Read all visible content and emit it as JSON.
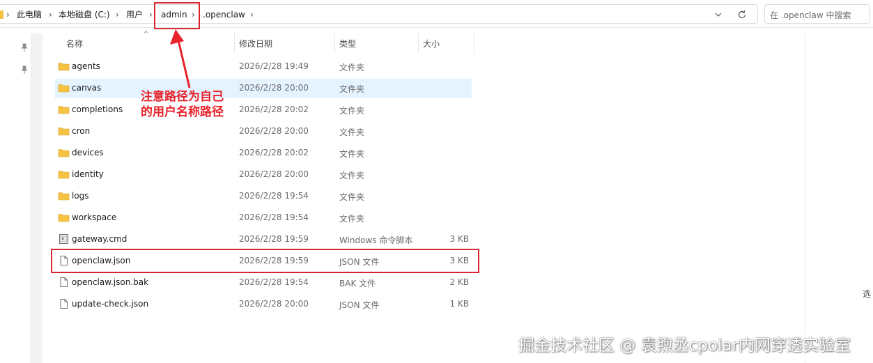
{
  "breadcrumb": {
    "items": [
      "此电脑",
      "本地磁盘 (C:)",
      "用户",
      "admin",
      ".openclaw"
    ]
  },
  "search": {
    "placeholder": "在 .openclaw 中搜索"
  },
  "columns": {
    "name": "名称",
    "modified": "修改日期",
    "type": "类型",
    "size": "大小"
  },
  "files": [
    {
      "name": "agents",
      "date": "2026/2/28 19:49",
      "type": "文件夹",
      "size": "",
      "icon": "folder-icon",
      "selected": false
    },
    {
      "name": "canvas",
      "date": "2026/2/28 20:00",
      "type": "文件夹",
      "size": "",
      "icon": "folder-icon",
      "selected": true
    },
    {
      "name": "completions",
      "date": "2026/2/28 20:02",
      "type": "文件夹",
      "size": "",
      "icon": "folder-icon",
      "selected": false
    },
    {
      "name": "cron",
      "date": "2026/2/28 20:00",
      "type": "文件夹",
      "size": "",
      "icon": "folder-icon",
      "selected": false
    },
    {
      "name": "devices",
      "date": "2026/2/28 20:02",
      "type": "文件夹",
      "size": "",
      "icon": "folder-icon",
      "selected": false
    },
    {
      "name": "identity",
      "date": "2026/2/28 20:00",
      "type": "文件夹",
      "size": "",
      "icon": "folder-icon",
      "selected": false
    },
    {
      "name": "logs",
      "date": "2026/2/28 19:54",
      "type": "文件夹",
      "size": "",
      "icon": "folder-icon",
      "selected": false
    },
    {
      "name": "workspace",
      "date": "2026/2/28 19:54",
      "type": "文件夹",
      "size": "",
      "icon": "folder-icon",
      "selected": false
    },
    {
      "name": "gateway.cmd",
      "date": "2026/2/28 19:59",
      "type": "Windows 命令脚本",
      "size": "3 KB",
      "icon": "script-file-icon",
      "selected": false
    },
    {
      "name": "openclaw.json",
      "date": "2026/2/28 19:59",
      "type": "JSON 文件",
      "size": "3 KB",
      "icon": "file-icon",
      "selected": false
    },
    {
      "name": "openclaw.json.bak",
      "date": "2026/2/28 19:54",
      "type": "BAK 文件",
      "size": "2 KB",
      "icon": "file-icon",
      "selected": false
    },
    {
      "name": "update-check.json",
      "date": "2026/2/28 20:00",
      "type": "JSON 文件",
      "size": "1 KB",
      "icon": "file-icon",
      "selected": false
    }
  ],
  "annotation": {
    "line1": "注意路径为自己",
    "line2": "的用户名称路径"
  },
  "side_char": "选",
  "watermark": "掘金技术社区 @ 袁煦丞cpolar内网穿透实验室",
  "colors": {
    "highlight": "#d9262e",
    "selection": "#e5f3ff",
    "folder": "#f5c244"
  }
}
